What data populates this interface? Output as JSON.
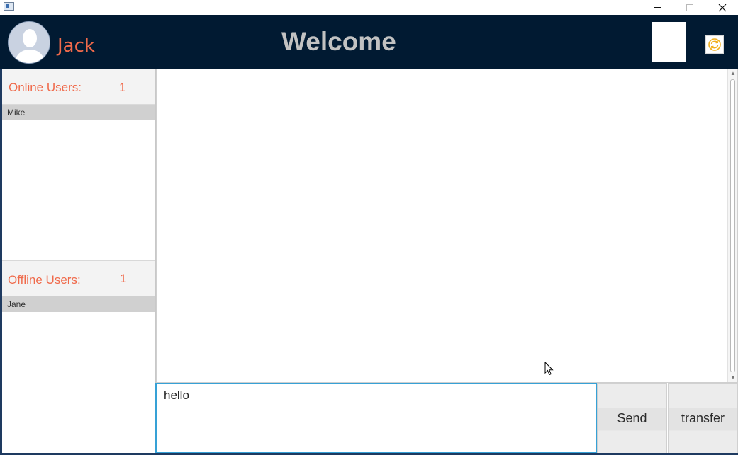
{
  "window": {
    "minimize_icon": "minimize-icon",
    "maximize_icon": "maximize-icon",
    "close_icon": "close-icon"
  },
  "header": {
    "username": "Jack",
    "title": "Welcome",
    "avatar_icon": "user-avatar-icon",
    "refresh_icon": "refresh-icon"
  },
  "online": {
    "label": "Online Users:",
    "count": "1",
    "users": [
      "Mike"
    ]
  },
  "offline": {
    "label": "Offline Users:",
    "count": "1",
    "users": [
      "Jane"
    ]
  },
  "composer": {
    "value": "hello",
    "send_label": "Send",
    "transfer_label": "transfer"
  },
  "colors": {
    "header_bg": "#011a32",
    "accent": "#f06a4b",
    "input_focus": "#36a1d6"
  }
}
